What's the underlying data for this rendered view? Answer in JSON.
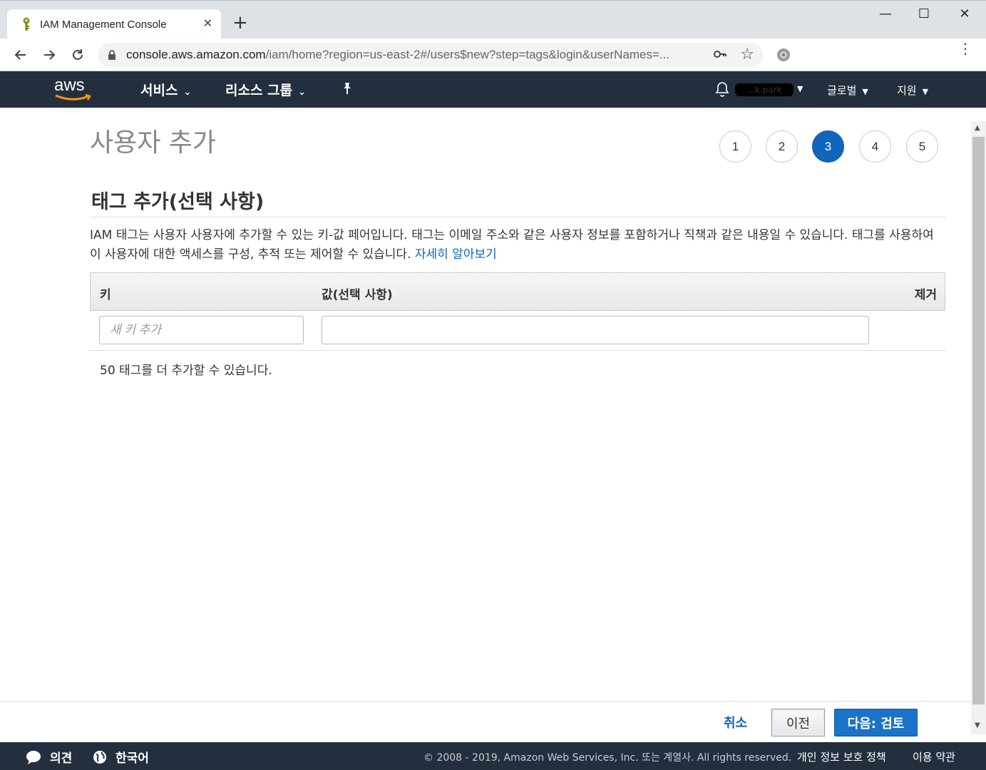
{
  "browser": {
    "tab_title": "IAM Management Console",
    "url_host": "console.aws.amazon.com",
    "url_path": "/iam/home?region=us-east-2#/users$new?step=tags&login&userNames=..."
  },
  "awsnav": {
    "logo": "aws",
    "services": "서비스",
    "resource_groups": "리소스 그룹",
    "user": "...k.park",
    "region": "글로벌",
    "support": "지원"
  },
  "page": {
    "title": "사용자 추가",
    "steps": [
      "1",
      "2",
      "3",
      "4",
      "5"
    ],
    "active_step": "3",
    "section_title": "태그 추가(선택 사항)",
    "description": "IAM 태그는 사용자 사용자에 추가할 수 있는 키-값 페어입니다. 태그는 이메일 주소와 같은 사용자 정보를 포함하거나 직책과 같은 내용일 수 있습니다. 태그를 사용하여 이 사용자에 대한 액세스를 구성, 추적 또는 제어할 수 있습니다. ",
    "learn_more": "자세히 알아보기"
  },
  "table": {
    "col_key": "키",
    "col_value": "값(선택 사항)",
    "col_remove": "제거",
    "key_placeholder": "새 키 추가",
    "key_value": "",
    "value_value": "",
    "remaining": "50 태그를 더 추가할 수 있습니다."
  },
  "actions": {
    "cancel": "취소",
    "previous": "이전",
    "next": "다음: 검토"
  },
  "footer": {
    "feedback": "의견",
    "language": "한국어",
    "copyright": "© 2008 - 2019, Amazon Web Services, Inc. 또는 계열사. All rights reserved.",
    "privacy": "개인 정보 보호 정책",
    "terms": "이용 약관"
  },
  "colors": {
    "aws_nav": "#232f3e",
    "primary_blue": "#1166bb",
    "aws_orange": "#ff9900"
  }
}
